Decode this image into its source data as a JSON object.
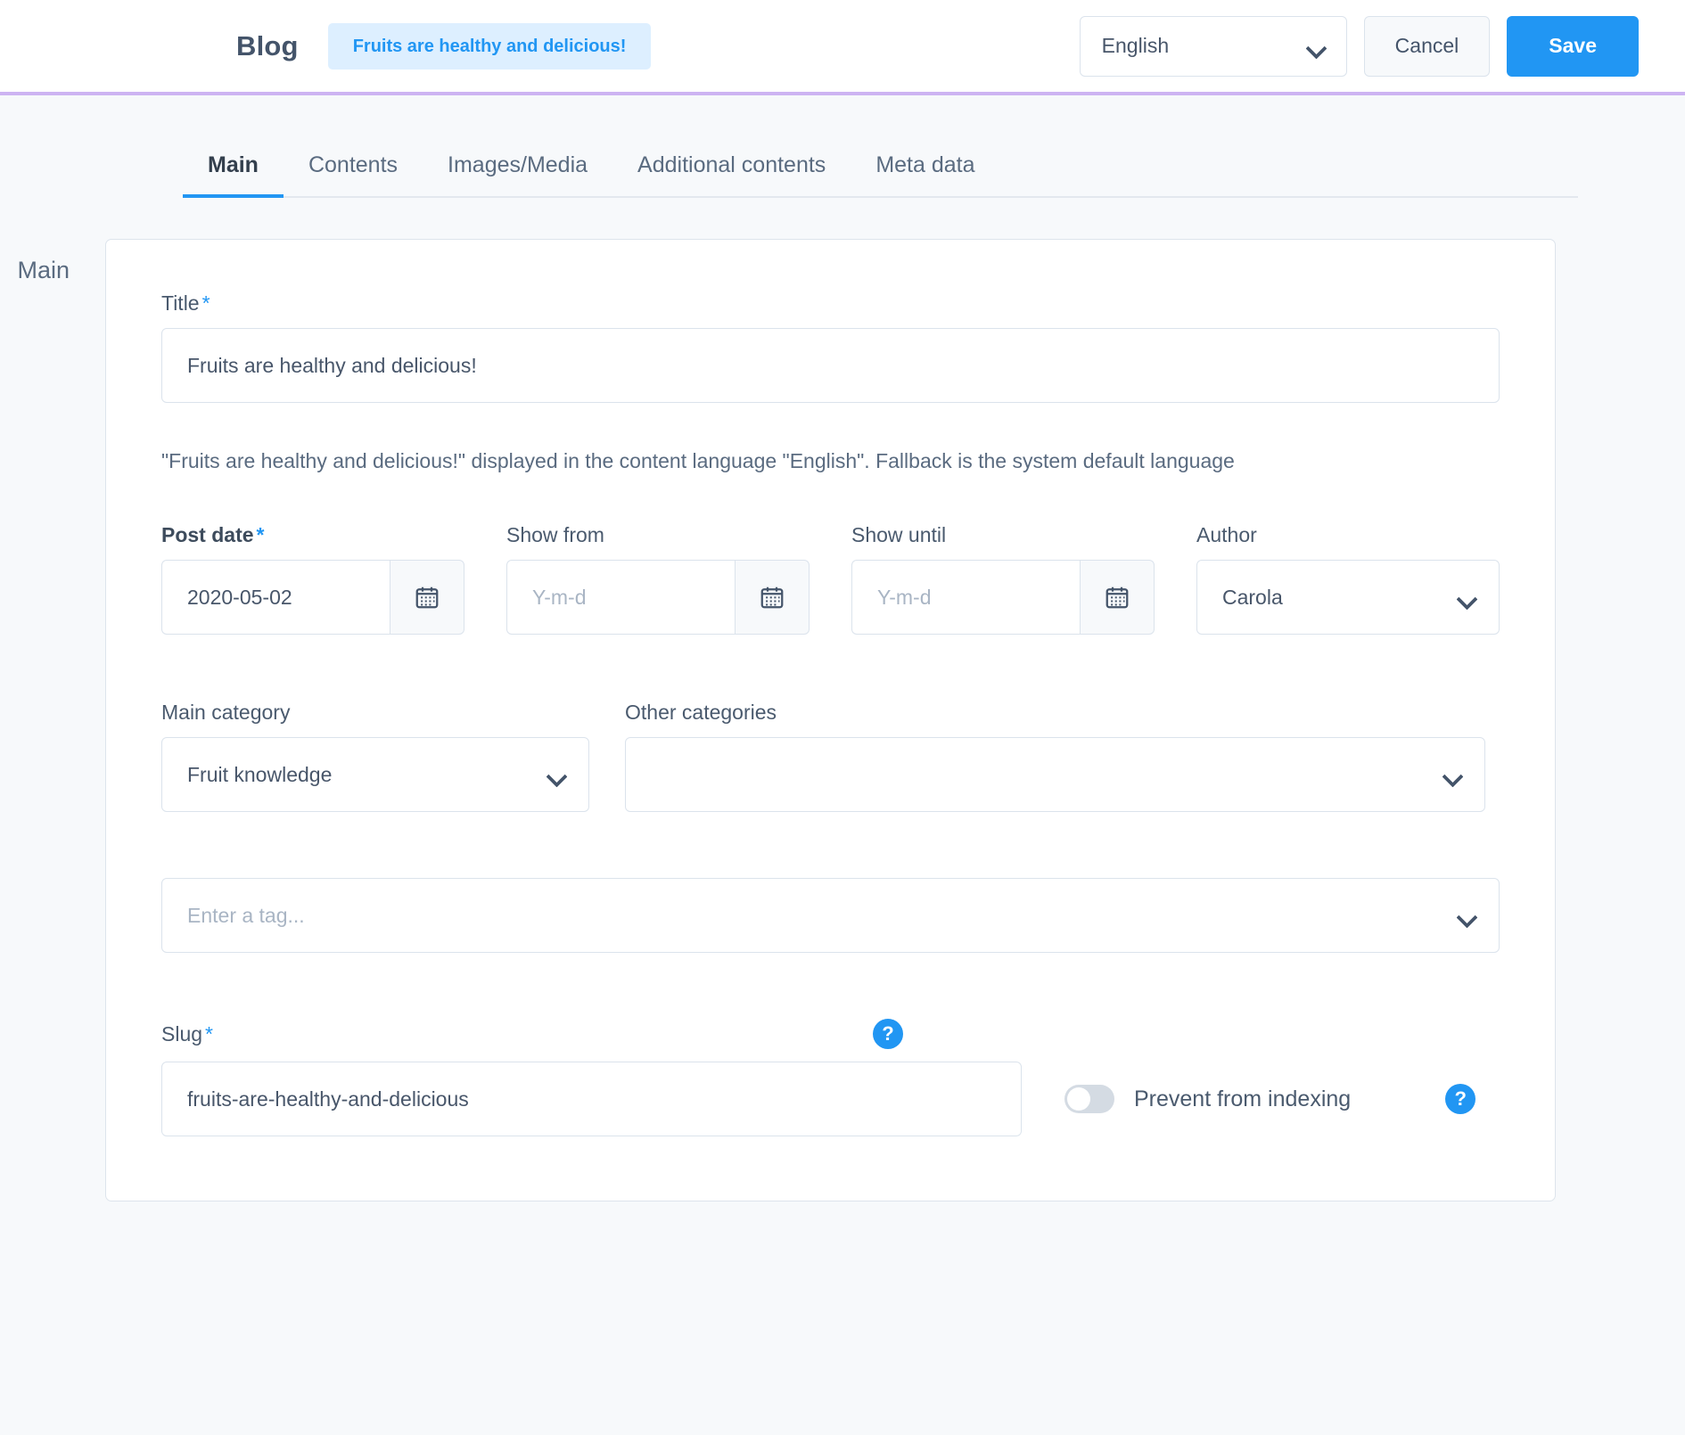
{
  "header": {
    "app_title": "Blog",
    "entity_chip": "Fruits are healthy and delicious!",
    "language": "English",
    "cancel_label": "Cancel",
    "save_label": "Save",
    "accent_color": "#2196f3",
    "border_color": "#cdb4f2"
  },
  "tabs": [
    {
      "label": "Main",
      "active": true
    },
    {
      "label": "Contents",
      "active": false
    },
    {
      "label": "Images/Media",
      "active": false
    },
    {
      "label": "Additional contents",
      "active": false
    },
    {
      "label": "Meta data",
      "active": false
    }
  ],
  "section": {
    "label": "Main"
  },
  "form": {
    "title": {
      "label": "Title",
      "required": "*",
      "value": "Fruits are healthy and delicious!"
    },
    "helper_text": "\"Fruits are healthy and delicious!\" displayed in the content language \"English\". Fallback is the system default language",
    "post_date": {
      "label": "Post date",
      "required": "*",
      "value": "2020-05-02",
      "icon": "calendar-icon"
    },
    "show_from": {
      "label": "Show from",
      "placeholder": "Y-m-d",
      "value": "",
      "icon": "calendar-icon"
    },
    "show_until": {
      "label": "Show until",
      "placeholder": "Y-m-d",
      "value": "",
      "icon": "calendar-icon"
    },
    "author": {
      "label": "Author",
      "value": "Carola"
    },
    "main_category": {
      "label": "Main category",
      "value": "Fruit knowledge"
    },
    "other_categories": {
      "label": "Other categories",
      "value": ""
    },
    "tags": {
      "placeholder": "Enter a tag...",
      "value": ""
    },
    "slug": {
      "label": "Slug",
      "required": "*",
      "value": "fruits-are-healthy-and-delicious",
      "help_icon": "?"
    },
    "prevent_indexing": {
      "label": "Prevent from indexing",
      "state": "off",
      "help_icon": "?"
    }
  }
}
